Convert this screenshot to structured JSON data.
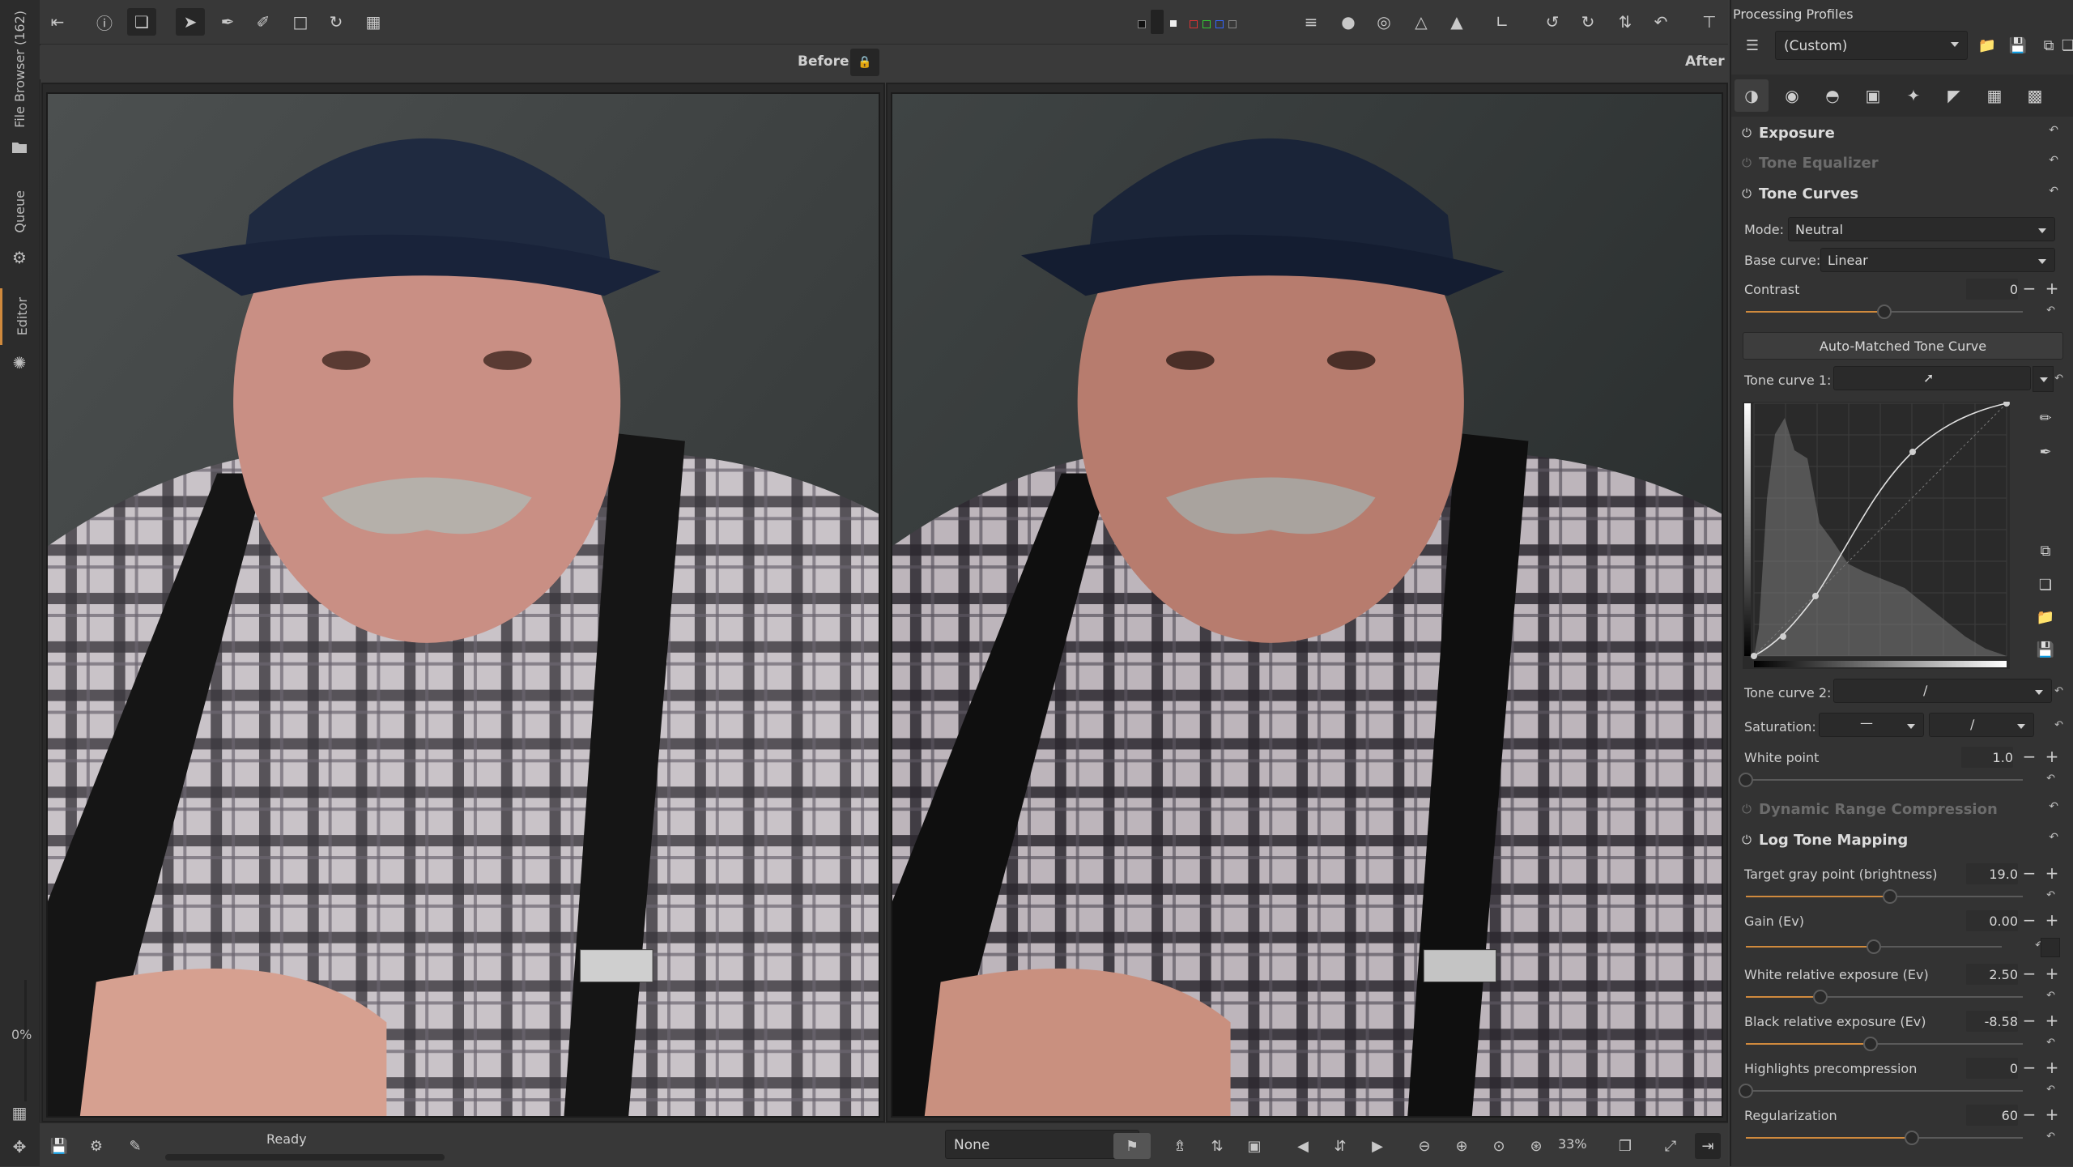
{
  "left_strip": {
    "tabs": [
      {
        "label": "File Browser (162)"
      },
      {
        "label": "Queue"
      },
      {
        "label": "Editor"
      }
    ],
    "zoom_percent": "0%"
  },
  "compare": {
    "before_label": "Before",
    "after_label": "After"
  },
  "status": {
    "text": "Ready",
    "progress": 0
  },
  "bottom_toolbar": {
    "color_label_value": "None",
    "zoom_value": "33%"
  },
  "right_panel": {
    "title": "Processing Profiles",
    "profile_value": "(Custom)",
    "sections": {
      "exposure": "Exposure",
      "tone_equalizer": "Tone Equalizer",
      "tone_curves": "Tone Curves",
      "drc": "Dynamic Range Compression",
      "log_tone_mapping": "Log Tone Mapping"
    },
    "tone_curves": {
      "mode_label": "Mode:",
      "mode_value": "Neutral",
      "base_curve_label": "Base curve:",
      "base_curve_value": "Linear",
      "contrast_label": "Contrast",
      "contrast_value": "0",
      "contrast_level": 0.5,
      "auto_button": "Auto-Matched Tone Curve",
      "curve1_label": "Tone curve 1:",
      "curve2_label": "Tone curve 2:",
      "saturation_label": "Saturation:",
      "white_point_label": "White point",
      "white_point_value": "1.0",
      "white_point_level": 0.0
    },
    "log_tone_mapping": {
      "target_gray_label": "Target gray point (brightness)",
      "target_gray_value": "19.0",
      "target_gray_level": 0.52,
      "gain_label": "Gain (Ev)",
      "gain_value": "0.00",
      "gain_level": 0.5,
      "white_rel_label": "White relative exposure (Ev)",
      "white_rel_value": "2.50",
      "white_rel_level": 0.27,
      "black_rel_label": "Black relative exposure (Ev)",
      "black_rel_value": "-8.58",
      "black_rel_level": 0.45,
      "highlights_label": "Highlights precompression",
      "highlights_value": "0",
      "highlights_level": 0.0,
      "regularization_label": "Regularization",
      "regularization_value": "60",
      "regularization_level": 0.6
    }
  },
  "colors": {
    "accent": "#d08a3d",
    "panel_bg": "#333333",
    "toolbar_bg": "#383838"
  }
}
